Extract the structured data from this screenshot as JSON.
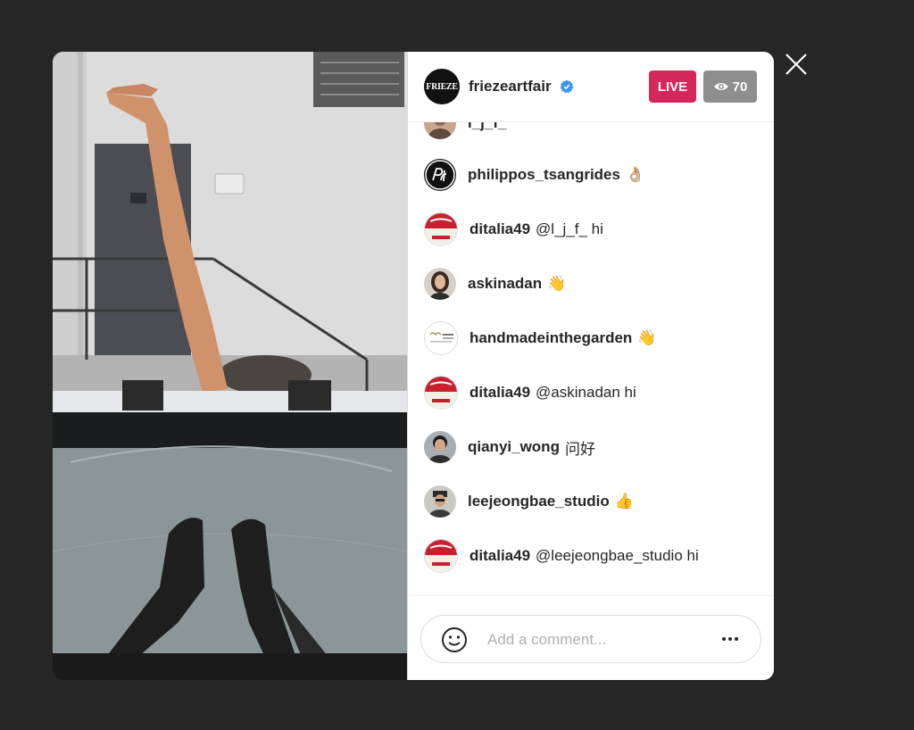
{
  "host": {
    "avatar_text": "FRIEZE",
    "username": "friezeartfair",
    "verified": true
  },
  "badges": {
    "live_label": "LIVE",
    "viewer_count": "70",
    "live_color": "#d6275b"
  },
  "comments": [
    {
      "username": "l_j_f_",
      "text": "",
      "avatar_icon": "user-photo-avatar",
      "partial": true
    },
    {
      "username": "philippos_tsangrides",
      "text": "👌🏼",
      "avatar_icon": "pat-logo-avatar"
    },
    {
      "username": "ditalia49",
      "text": "@l_j_f_ hi",
      "avatar_icon": "soup-can-avatar"
    },
    {
      "username": "askinadan",
      "text": "👋",
      "avatar_icon": "user-photo-avatar"
    },
    {
      "username": "handmadeinthegarden",
      "text": "👋",
      "avatar_icon": "garden-logo-avatar"
    },
    {
      "username": "ditalia49",
      "text": "@askinadan hi",
      "avatar_icon": "soup-can-avatar"
    },
    {
      "username": "qianyi_wong",
      "text": "问好",
      "avatar_icon": "user-photo-avatar"
    },
    {
      "username": "leejeongbae_studio",
      "text": "👍",
      "avatar_icon": "user-photo-avatar"
    },
    {
      "username": "ditalia49",
      "text": "@leejeongbae_studio hi",
      "avatar_icon": "soup-can-avatar"
    }
  ],
  "composer": {
    "placeholder": "Add a comment...",
    "value": ""
  }
}
